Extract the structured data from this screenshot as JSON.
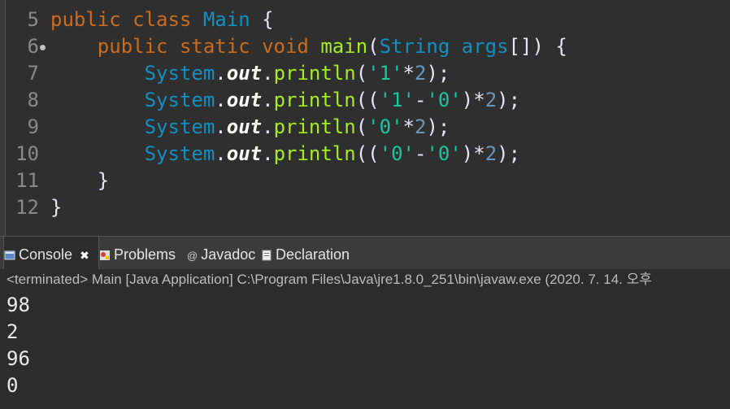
{
  "editor": {
    "lines": [
      {
        "no": "5",
        "code": [
          {
            "t": "public class ",
            "c": "kw"
          },
          {
            "t": "Main",
            "c": "cls"
          },
          {
            "t": " {",
            "c": "txt"
          }
        ]
      },
      {
        "no": "6",
        "code": [
          {
            "t": "    public static void ",
            "c": "kw"
          },
          {
            "t": "main",
            "c": "mtd"
          },
          {
            "t": "(",
            "c": "txt"
          },
          {
            "t": "String",
            "c": "cls"
          },
          {
            "t": " args",
            "c": "cls"
          },
          {
            "t": "[]) {",
            "c": "txt"
          }
        ]
      },
      {
        "no": "7",
        "code": [
          {
            "t": "        System",
            "c": "cls"
          },
          {
            "t": ".",
            "c": "txt"
          },
          {
            "t": "out",
            "c": "fld"
          },
          {
            "t": ".",
            "c": "txt"
          },
          {
            "t": "println",
            "c": "mtd"
          },
          {
            "t": "(",
            "c": "txt"
          },
          {
            "t": "'1'",
            "c": "str"
          },
          {
            "t": "*",
            "c": "txt"
          },
          {
            "t": "2",
            "c": "num"
          },
          {
            "t": ");",
            "c": "txt"
          }
        ]
      },
      {
        "no": "8",
        "code": [
          {
            "t": "        System",
            "c": "cls"
          },
          {
            "t": ".",
            "c": "txt"
          },
          {
            "t": "out",
            "c": "fld"
          },
          {
            "t": ".",
            "c": "txt"
          },
          {
            "t": "println",
            "c": "mtd"
          },
          {
            "t": "((",
            "c": "txt"
          },
          {
            "t": "'1'",
            "c": "str"
          },
          {
            "t": "-",
            "c": "txt"
          },
          {
            "t": "'0'",
            "c": "str"
          },
          {
            "t": ")*",
            "c": "txt"
          },
          {
            "t": "2",
            "c": "num"
          },
          {
            "t": ");",
            "c": "txt"
          }
        ]
      },
      {
        "no": "9",
        "code": [
          {
            "t": "        System",
            "c": "cls"
          },
          {
            "t": ".",
            "c": "txt"
          },
          {
            "t": "out",
            "c": "fld"
          },
          {
            "t": ".",
            "c": "txt"
          },
          {
            "t": "println",
            "c": "mtd"
          },
          {
            "t": "(",
            "c": "txt"
          },
          {
            "t": "'0'",
            "c": "str"
          },
          {
            "t": "*",
            "c": "txt"
          },
          {
            "t": "2",
            "c": "num"
          },
          {
            "t": ");",
            "c": "txt"
          }
        ]
      },
      {
        "no": "10",
        "code": [
          {
            "t": "        System",
            "c": "cls"
          },
          {
            "t": ".",
            "c": "txt"
          },
          {
            "t": "out",
            "c": "fld"
          },
          {
            "t": ".",
            "c": "txt"
          },
          {
            "t": "println",
            "c": "mtd"
          },
          {
            "t": "((",
            "c": "txt"
          },
          {
            "t": "'0'",
            "c": "str"
          },
          {
            "t": "-",
            "c": "txt"
          },
          {
            "t": "'0'",
            "c": "str"
          },
          {
            "t": ")*",
            "c": "txt"
          },
          {
            "t": "2",
            "c": "num"
          },
          {
            "t": ");",
            "c": "txt"
          }
        ]
      },
      {
        "no": "11",
        "code": [
          {
            "t": "    }",
            "c": "txt"
          }
        ]
      },
      {
        "no": "12",
        "code": [
          {
            "t": "}",
            "c": "txt"
          }
        ]
      }
    ]
  },
  "tabs": {
    "console": "Console",
    "problems": "Problems",
    "javadoc": "Javadoc",
    "declaration": "Declaration"
  },
  "status": "<terminated> Main [Java Application] C:\\Program Files\\Java\\jre1.8.0_251\\bin\\javaw.exe (2020. 7. 14. 오후",
  "output": [
    "98",
    "2",
    "96",
    "0"
  ],
  "colors": {
    "keyword": "#cc6c1d",
    "class": "#1290c3",
    "method": "#a7ec21",
    "string": "#17c6a3",
    "background": "#2f2f2f"
  }
}
